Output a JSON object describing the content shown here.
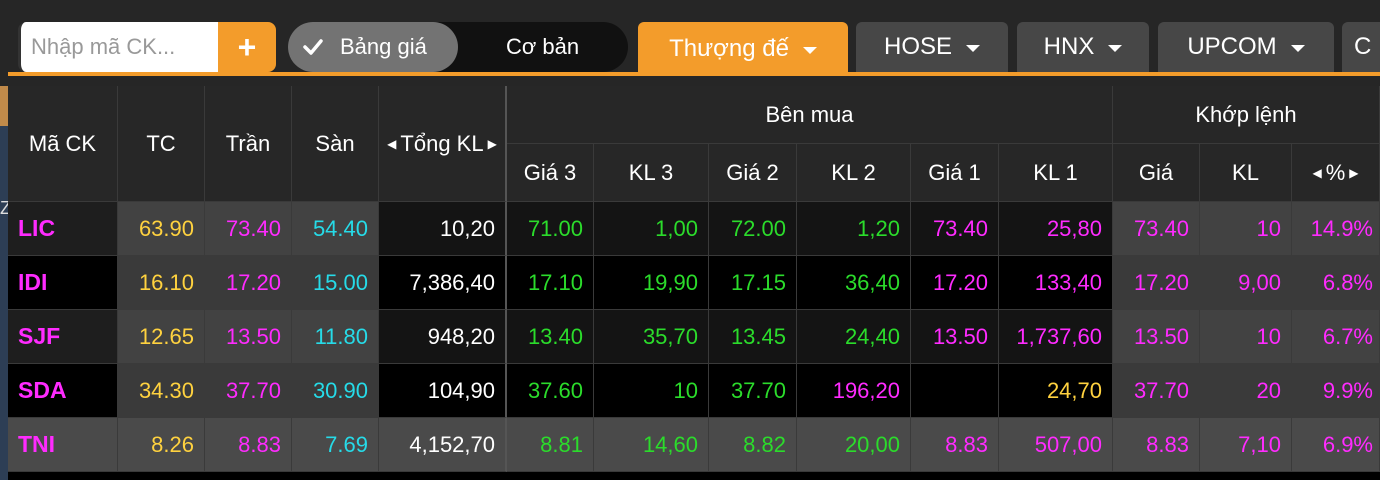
{
  "toolbar": {
    "search_placeholder": "Nhập mã CK...",
    "add_icon": "plus-icon",
    "view_modes": [
      "Bảng giá",
      "Cơ bản"
    ],
    "active_view": "Bảng giá",
    "tabs": [
      {
        "label": "Thượng đế",
        "active": true
      },
      {
        "label": "HOSE",
        "active": false
      },
      {
        "label": "HNX",
        "active": false
      },
      {
        "label": "UPCOM",
        "active": false
      },
      {
        "label": "C",
        "active": false
      }
    ],
    "accent_color": "#f39c2b"
  },
  "edge_text": "Z",
  "table": {
    "headers": {
      "ma_ck": "Mã CK",
      "tc": "TC",
      "tran": "Trần",
      "san": "Sàn",
      "tong_kl": "Tổng KL",
      "ben_mua": "Bên mua",
      "khop_lenh": "Khớp lệnh",
      "gia3": "Giá 3",
      "kl3": "KL 3",
      "gia2": "Giá 2",
      "kl2": "KL 2",
      "gia1": "Giá 1",
      "kl1": "KL 1",
      "gia": "Giá",
      "kl": "KL",
      "pct": "%"
    },
    "rows": [
      {
        "ma": "LIC",
        "tc": "63.90",
        "tran": "73.40",
        "san": "54.40",
        "tong_kl": "10,20",
        "gia3": "71.00",
        "kl3": "1,00",
        "gia2": "72.00",
        "kl2": "1,20",
        "gia1": "73.40",
        "kl1": "25,80",
        "gia": "73.40",
        "kl": "10",
        "pct": "14.9%"
      },
      {
        "ma": "IDI",
        "tc": "16.10",
        "tran": "17.20",
        "san": "15.00",
        "tong_kl": "7,386,40",
        "gia3": "17.10",
        "kl3": "19,90",
        "gia2": "17.15",
        "kl2": "36,40",
        "gia1": "17.20",
        "kl1": "133,40",
        "gia": "17.20",
        "kl": "9,00",
        "pct": "6.8%"
      },
      {
        "ma": "SJF",
        "tc": "12.65",
        "tran": "13.50",
        "san": "11.80",
        "tong_kl": "948,20",
        "gia3": "13.40",
        "kl3": "35,70",
        "gia2": "13.45",
        "kl2": "24,40",
        "gia1": "13.50",
        "kl1": "1,737,60",
        "gia": "13.50",
        "kl": "10",
        "pct": "6.7%"
      },
      {
        "ma": "SDA",
        "tc": "34.30",
        "tran": "37.70",
        "san": "30.90",
        "tong_kl": "104,90",
        "gia3": "37.60",
        "kl3": "10",
        "gia2": "37.70",
        "kl2": "196,20",
        "gia1": "",
        "kl1": "24,70",
        "gia": "37.70",
        "kl": "20",
        "pct": "9.9%"
      },
      {
        "ma": "TNI",
        "tc": "8.26",
        "tran": "8.83",
        "san": "7.69",
        "tong_kl": "4,152,70",
        "gia3": "8.81",
        "kl3": "14,60",
        "gia2": "8.82",
        "kl2": "20,00",
        "gia1": "8.83",
        "kl1": "507,00",
        "gia": "8.83",
        "kl": "7,10",
        "pct": "6.9%"
      }
    ],
    "colors": {
      "ceiling": "#ff2bff",
      "floor": "#26dbe8",
      "reference": "#ffd23f",
      "up": "#2bdc2b",
      "neutral": "#ffffff",
      "kl1_sda": "#ffd23f",
      "kl2_sda": "#ff2bff"
    }
  }
}
